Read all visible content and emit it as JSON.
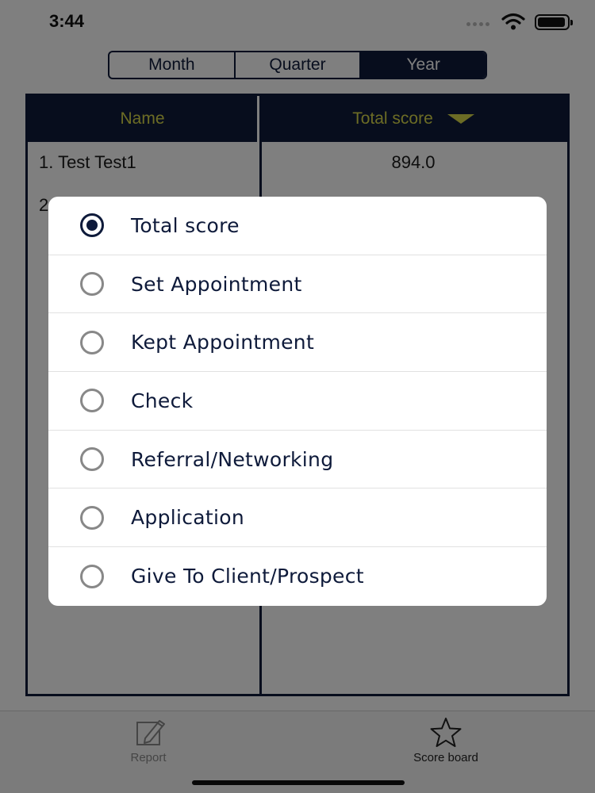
{
  "status_bar": {
    "time": "3:44"
  },
  "period_tabs": [
    {
      "label": "Month",
      "active": false
    },
    {
      "label": "Quarter",
      "active": false
    },
    {
      "label": "Year",
      "active": true
    }
  ],
  "table": {
    "columns": {
      "name": "Name",
      "score": "Total score"
    },
    "rows": [
      {
        "name": "1. Test Test1",
        "score": "894.0"
      },
      {
        "name": "2",
        "score": ""
      }
    ]
  },
  "sort_options": [
    {
      "label": "Total score",
      "selected": true
    },
    {
      "label": "Set Appointment",
      "selected": false
    },
    {
      "label": "Kept Appointment",
      "selected": false
    },
    {
      "label": "Check",
      "selected": false
    },
    {
      "label": "Referral/Networking",
      "selected": false
    },
    {
      "label": "Application",
      "selected": false
    },
    {
      "label": "Give To Client/Prospect",
      "selected": false
    }
  ],
  "tab_bar": {
    "report": {
      "label": "Report",
      "icon": "pencil-square-icon"
    },
    "scoreboard": {
      "label": "Score board",
      "icon": "star-icon"
    }
  },
  "colors": {
    "navy": "#0e1a3a",
    "header_text": "#d8d84a"
  }
}
